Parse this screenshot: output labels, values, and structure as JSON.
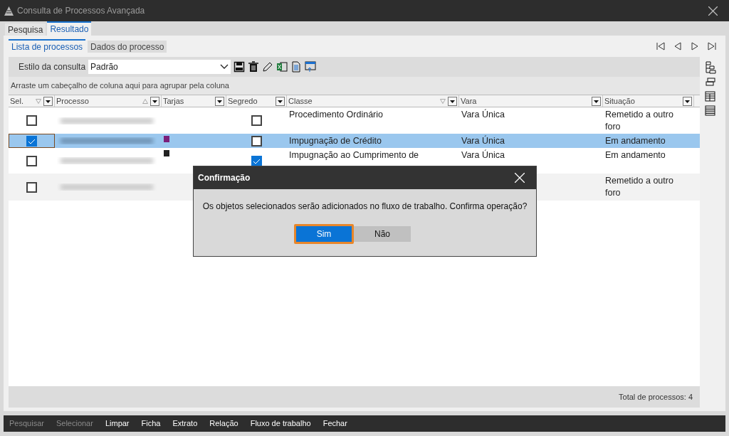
{
  "window": {
    "title": "Consulta de Processos Avançada"
  },
  "tabs": [
    {
      "label": "Pesquisa",
      "selected": false
    },
    {
      "label": "Resultado",
      "selected": true
    }
  ],
  "subtabs": [
    {
      "label": "Lista de processos",
      "selected": true
    },
    {
      "label": "Dados do processo",
      "selected": false
    }
  ],
  "toolbar": {
    "label": "Estilo da consulta",
    "value": "Padrão"
  },
  "group_hint": "Arraste um cabeçalho de coluna aqui para agrupar pela coluna",
  "table": {
    "columns": [
      {
        "label": "Sel.",
        "filtered": true,
        "sorted": false
      },
      {
        "label": "Processo",
        "filtered": false,
        "sorted": true
      },
      {
        "label": "Tarjas",
        "filtered": false,
        "sorted": false
      },
      {
        "label": "Segredo",
        "filtered": false,
        "sorted": false
      },
      {
        "label": "Classe",
        "filtered": true,
        "sorted": false
      },
      {
        "label": "Vara",
        "filtered": false,
        "sorted": false
      },
      {
        "label": "Situação",
        "filtered": false,
        "sorted": false
      }
    ],
    "rows": [
      {
        "checked": false,
        "selected": false,
        "secret": false,
        "classe": "Procedimento Ordinário",
        "vara": "Vara Única",
        "situacao": "Remetido a outro foro"
      },
      {
        "checked": true,
        "selected": true,
        "color": "#7b1f7b",
        "secret": false,
        "classe": "Impugnação de Crédito",
        "vara": "Vara Única",
        "situacao": "Em andamento"
      },
      {
        "checked": false,
        "selected": false,
        "color": "#222222",
        "secret": true,
        "classe": "Impugnação ao Cumprimento de",
        "vara": "Vara Única",
        "situacao": "Em andamento"
      },
      {
        "checked": false,
        "selected": false,
        "situacao": "Remetido a outro foro"
      }
    ]
  },
  "total": "Total de processos: 4",
  "actions": [
    {
      "label": "Pesquisar",
      "disabled": true
    },
    {
      "label": "Selecionar",
      "disabled": true
    },
    {
      "label": "Limpar",
      "disabled": false
    },
    {
      "label": "Ficha",
      "disabled": false
    },
    {
      "label": "Extrato",
      "disabled": false
    },
    {
      "label": "Relação",
      "disabled": false
    },
    {
      "label": "Fluxo de trabalho",
      "disabled": false
    },
    {
      "label": "Fechar",
      "disabled": false
    }
  ],
  "dialog": {
    "title": "Confirmação",
    "message": "Os objetos selecionados serão adicionados no fluxo de trabalho. Confirma operação?",
    "buttons": [
      {
        "label": "Sim",
        "focused": true
      },
      {
        "label": "Não",
        "focused": false
      }
    ]
  }
}
